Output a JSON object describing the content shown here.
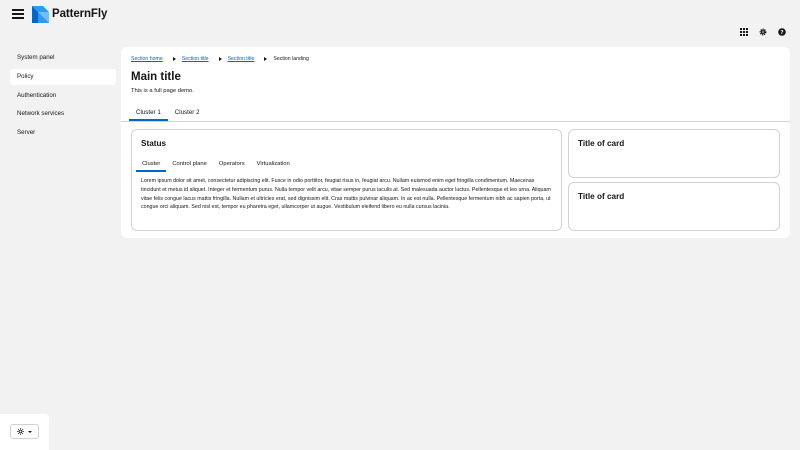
{
  "brand": {
    "name": "PatternFly",
    "mark_colors": [
      "#2b9af3",
      "#0066cc",
      "#73bcf7"
    ]
  },
  "masthead": {
    "menu_icon": "hamburger-icon",
    "tools": [
      "apps-grid-icon",
      "gear-icon",
      "help-icon"
    ]
  },
  "sidebar": {
    "items": [
      {
        "label": "System panel",
        "active": false
      },
      {
        "label": "Policy",
        "active": true
      },
      {
        "label": "Authentication",
        "active": false
      },
      {
        "label": "Network services",
        "active": false
      },
      {
        "label": "Server",
        "active": false
      }
    ]
  },
  "breadcrumb": {
    "items": [
      "Section home",
      "Section title",
      "Section title"
    ],
    "current": "Section landing"
  },
  "page": {
    "title": "Main title",
    "description": "This is a full page demo.",
    "tabs": [
      "Cluster 1",
      "Cluster 2"
    ]
  },
  "status_card": {
    "title": "Status",
    "tabs": [
      "Cluster",
      "Control plane",
      "Operators",
      "Virtualization"
    ],
    "body": "Lorem ipsum dolor sit amet, consectetur adipiscing elit. Fusce in odio porttitor, feugiat risus in, feugiat arcu. Nullam euismod enim eget fringilla condimentum. Maecenas tincidunt et metus id aliquet. Integer et fermentum purus. Nulla tempor velit arcu, vitae semper purus iaculis at. Sed malesuada auctor luctus. Pellentesque et leo urna. Aliquam vitae felis congue lacus mattis fringilla. Nullam et ultricies erat, sed dignissim elit. Cras mattis pulvinar aliquam. In ac est nulla. Pellentesque fermentum nibh ac sapien porta, ut congue orci aliquam. Sed nisl est, tempor eu pharetra eget, ullamcorper ut augue. Vestibulum eleifend libero eu nulla cursus lacinia."
  },
  "side_cards": [
    {
      "title": "Title of card"
    },
    {
      "title": "Title of card"
    }
  ],
  "theme_toggle": {
    "icon": "sun-icon"
  },
  "colors": {
    "link": "#0066cc",
    "active_tab": "#0066cc"
  }
}
